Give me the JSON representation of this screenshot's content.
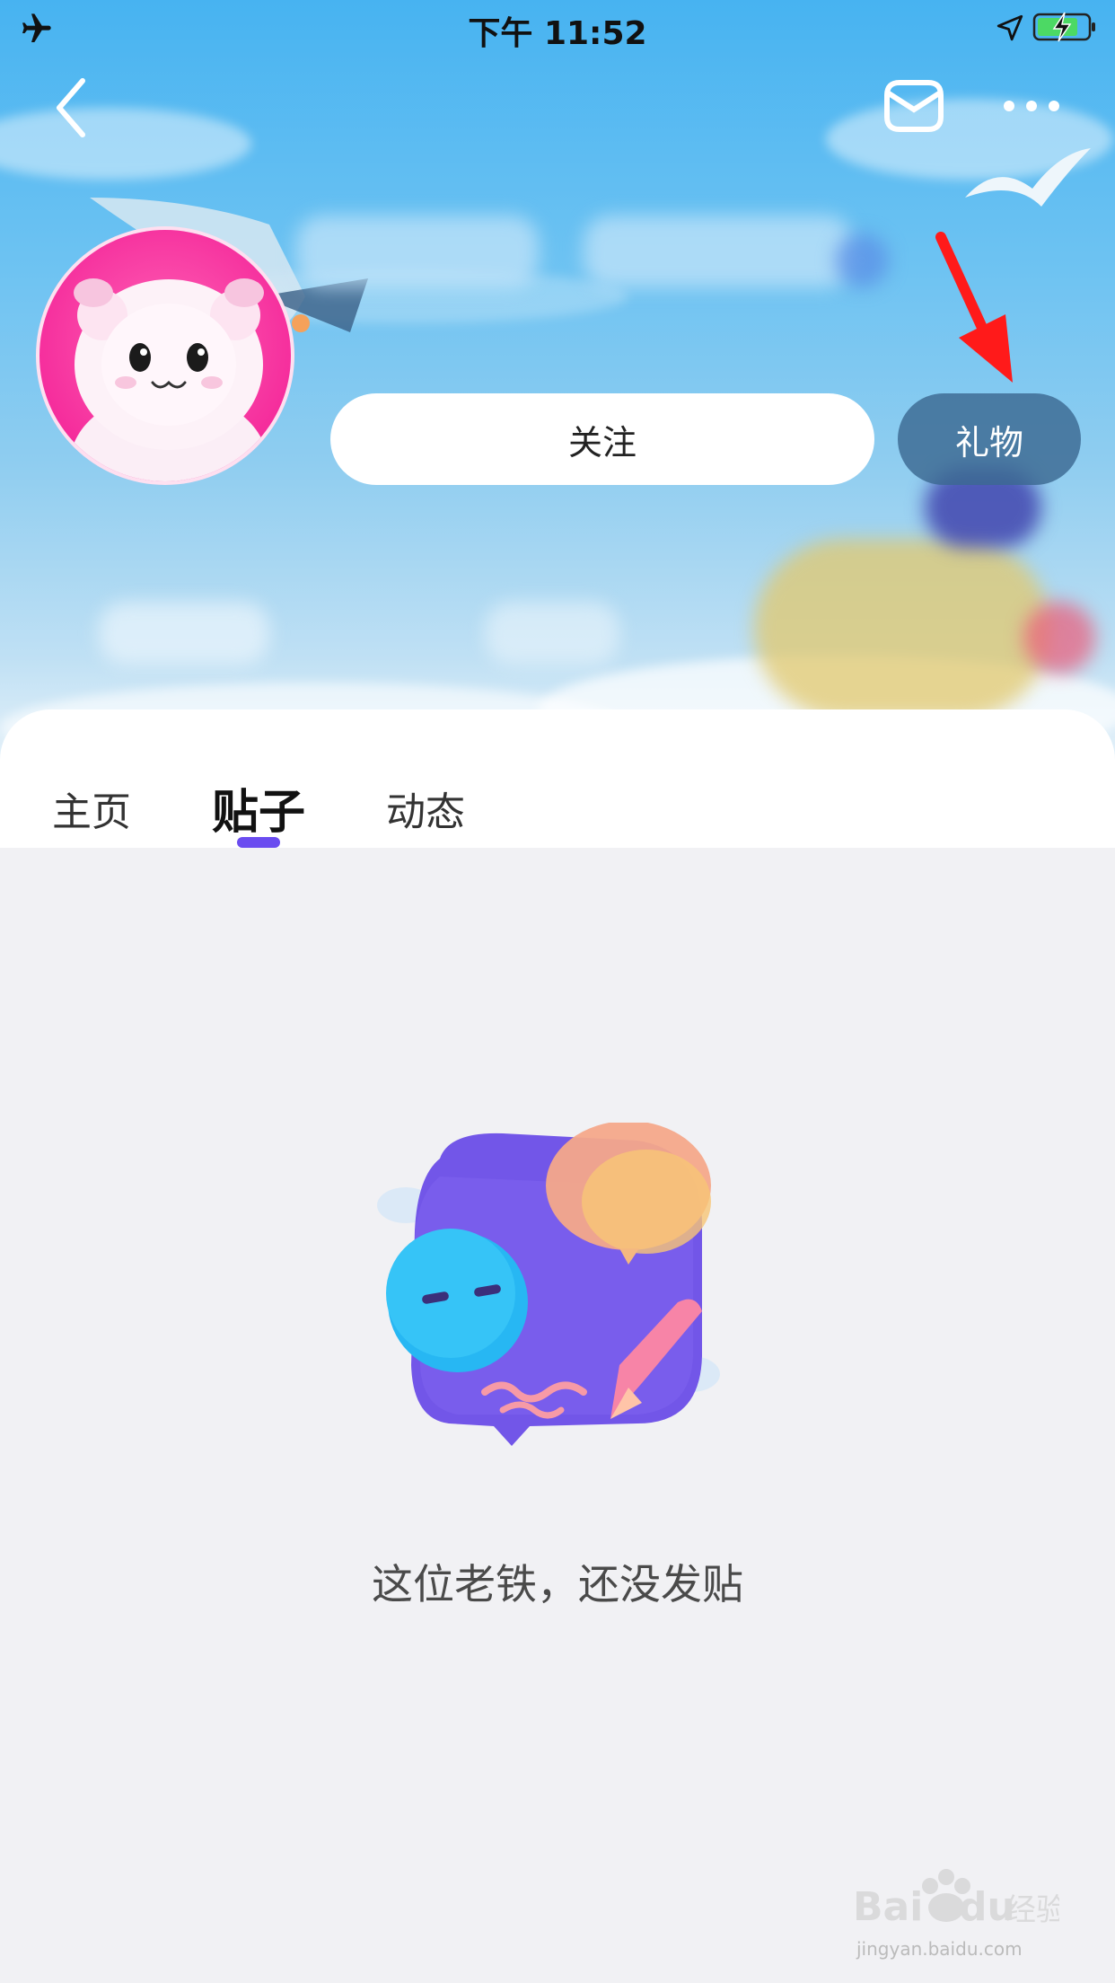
{
  "status_bar": {
    "time": "下午 11:52",
    "icons": [
      "airplane-icon",
      "location-arrow-icon",
      "battery-charging-icon"
    ]
  },
  "nav": {
    "icons": [
      "chevron-left-icon",
      "mail-icon",
      "more-icon"
    ]
  },
  "profile": {
    "follow_label": "关注",
    "gift_label": "礼物"
  },
  "tabs": [
    {
      "label": "主页",
      "active": false
    },
    {
      "label": "贴子",
      "active": true
    },
    {
      "label": "动态",
      "active": false
    }
  ],
  "empty_state": {
    "message": "这位老铁，还没发贴"
  },
  "watermark": {
    "brand": "Baidu经验",
    "url": "jingyan.baidu.com"
  },
  "colors": {
    "accent": "#6a4cf0",
    "gift_button": "#3c6991",
    "annotation_arrow": "#ff1a1a",
    "background": "#f1f1f4"
  }
}
